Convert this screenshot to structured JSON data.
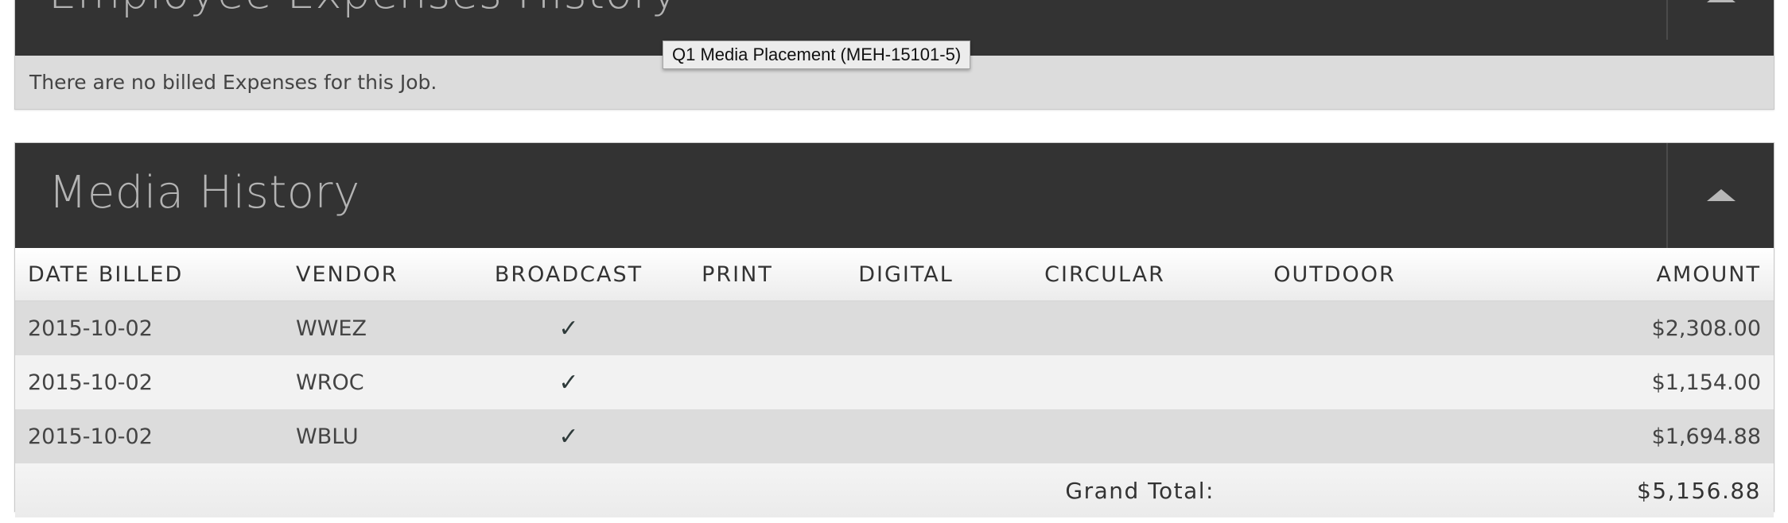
{
  "expenses_panel": {
    "title": "Employee Expenses History",
    "empty_message": "There are no billed Expenses for this Job."
  },
  "tooltip": {
    "text": "Q1 Media Placement (MEH-15101-5)"
  },
  "media_panel": {
    "title": "Media History",
    "columns": {
      "date_billed": "DATE BILLED",
      "vendor": "VENDOR",
      "broadcast": "BROADCAST",
      "print": "PRINT",
      "digital": "DIGITAL",
      "circular": "CIRCULAR",
      "outdoor": "OUTDOOR",
      "amount": "AMOUNT"
    },
    "rows": [
      {
        "date": "2015-10-02",
        "vendor": "WWEZ",
        "broadcast": "✓",
        "print": "",
        "digital": "",
        "circular": "",
        "outdoor": "",
        "amount": "$2,308.00"
      },
      {
        "date": "2015-10-02",
        "vendor": "WROC",
        "broadcast": "✓",
        "print": "",
        "digital": "",
        "circular": "",
        "outdoor": "",
        "amount": "$1,154.00"
      },
      {
        "date": "2015-10-02",
        "vendor": "WBLU",
        "broadcast": "✓",
        "print": "",
        "digital": "",
        "circular": "",
        "outdoor": "",
        "amount": "$1,694.88"
      }
    ],
    "grand_total_label": "Grand Total:",
    "grand_total_value": "$5,156.88"
  },
  "icons": {
    "collapse": "chevron-up-icon",
    "check": "checkmark-icon"
  }
}
